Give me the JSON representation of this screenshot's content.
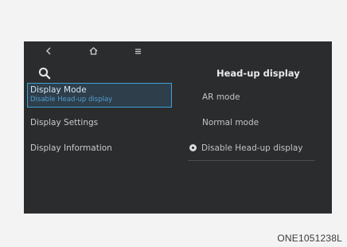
{
  "topbar": {
    "back_icon": "chevron-left-icon",
    "home_icon": "home-icon",
    "menu_icon": "menu-icon"
  },
  "search": {
    "icon": "search-icon"
  },
  "menu": {
    "items": [
      {
        "label": "Display Mode",
        "sub": "Disable Head-up display",
        "active": true
      },
      {
        "label": "Display Settings",
        "sub": "",
        "active": false
      },
      {
        "label": "Display Information",
        "sub": "",
        "active": false
      }
    ]
  },
  "panel": {
    "title": "Head-up display",
    "options": [
      {
        "label": "AR mode",
        "selected": false
      },
      {
        "label": "Normal mode",
        "selected": false
      },
      {
        "label": "Disable Head-up display",
        "selected": true
      }
    ]
  },
  "figure_code": "ONE1051238L",
  "colors": {
    "screen_bg": "#2b2c2e",
    "accent": "#3fa2d6",
    "active_bg": "#2e3e4b",
    "page_bg": "#f3f3f3"
  }
}
